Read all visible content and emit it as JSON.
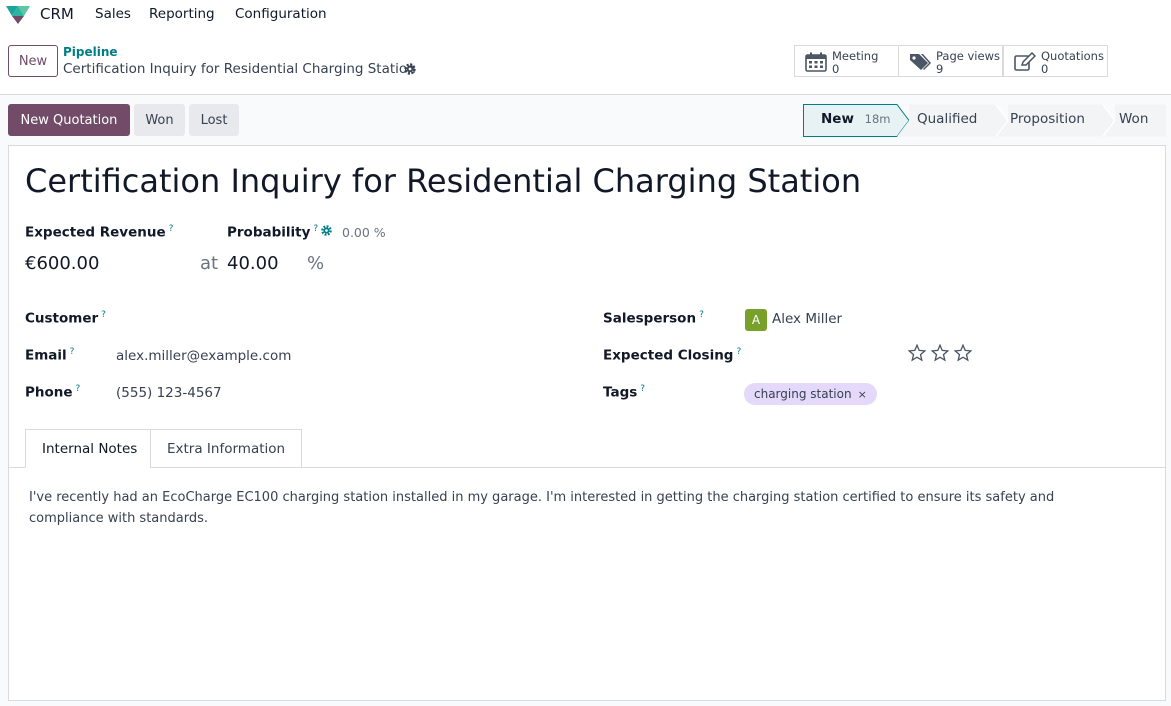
{
  "navbar": {
    "app_name": "CRM",
    "menu": [
      "Sales",
      "Reporting",
      "Configuration"
    ]
  },
  "control_panel": {
    "new_label": "New",
    "breadcrumb": "Pipeline",
    "record_name": "Certification Inquiry for Residential Charging Station",
    "stat_buttons": [
      {
        "label": "Meeting",
        "value": "0",
        "icon": "calendar-icon"
      },
      {
        "label": "Page views",
        "value": "9",
        "icon": "tags-icon"
      },
      {
        "label": "Quotations",
        "value": "0",
        "icon": "edit-icon"
      }
    ]
  },
  "actions": {
    "new_quotation": "New Quotation",
    "won": "Won",
    "lost": "Lost"
  },
  "stages": {
    "items": [
      "New",
      "Qualified",
      "Proposition",
      "Won"
    ],
    "active": "New",
    "active_duration": "18m"
  },
  "form": {
    "title": "Certification Inquiry for Residential Charging Station",
    "expected_revenue_label": "Expected Revenue",
    "probability_label": "Probability",
    "probability_auto": "0.00 %",
    "revenue_value": "€600.00",
    "at_label": "at",
    "probability_value": "40.00",
    "percent_sign": "%",
    "help_mark": "?",
    "customer_label": "Customer",
    "customer_value": "",
    "email_label": "Email",
    "email_value": "alex.miller@example.com",
    "phone_label": "Phone",
    "phone_value": "(555) 123-4567",
    "salesperson_label": "Salesperson",
    "salesperson_initial": "A",
    "salesperson_value": "Alex Miller",
    "expected_closing_label": "Expected Closing",
    "priority_stars": 0,
    "priority_max": 3,
    "tags_label": "Tags",
    "tags": [
      "charging station"
    ],
    "tag_remove": "×"
  },
  "tabs": {
    "items": [
      "Internal Notes",
      "Extra Information"
    ],
    "active": "Internal Notes"
  },
  "notes": "I've recently had an EcoCharge EC100 charging station installed in my garage. I'm interested in getting the charging station certified to ensure its safety and compliance with standards.",
  "colors": {
    "brand": "#714b67",
    "teal": "#017e84",
    "avatar": "#7aa02c",
    "tag_bg": "#e5d9fb"
  }
}
